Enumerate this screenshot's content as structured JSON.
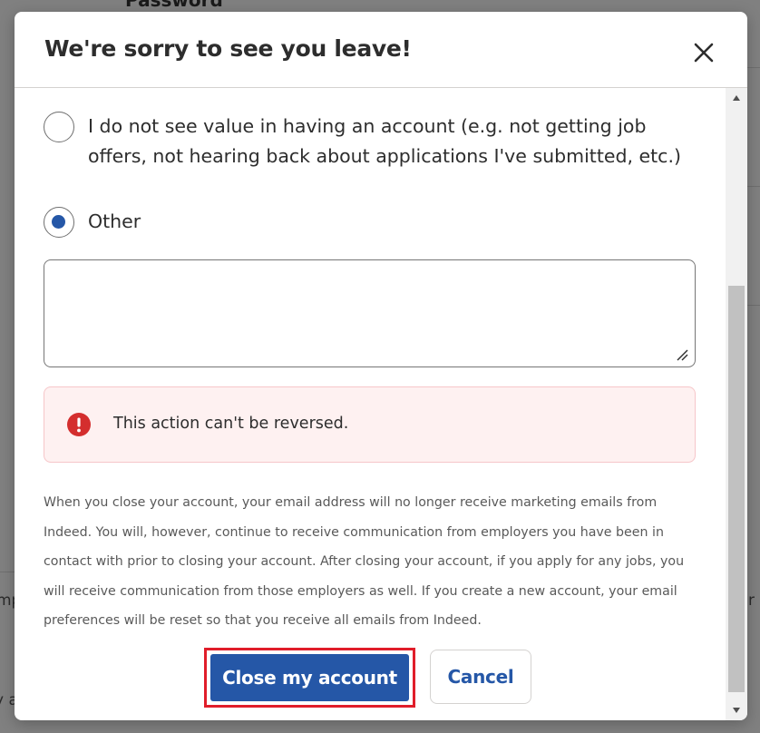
{
  "background": {
    "top_heading": "Password",
    "left_fragment_1": "mp",
    "left_fragment_2": "y a",
    "right_fragment_1": "r"
  },
  "modal": {
    "title": "We're sorry to see you leave!",
    "close_icon": "close-icon"
  },
  "options": [
    {
      "label": "I do not see value in having an account (e.g. not getting job offers, not hearing back about applications I've submitted, etc.)",
      "checked": false
    },
    {
      "label": "Other",
      "checked": true
    }
  ],
  "comment": {
    "value": ""
  },
  "alert": {
    "icon": "alert-circle-icon",
    "text": "This action can't be reversed.",
    "color": "#d42e2e"
  },
  "info": "When you close your account, your email address will no longer receive marketing emails from Indeed. You will, however, continue to receive communication from employers you have been in contact with prior to closing your account. After closing your account, if you apply for any jobs, you will receive communication from those employers as well. If you create a new account, your email preferences will be reset so that you receive all emails from Indeed.",
  "buttons": {
    "primary": "Close my account",
    "secondary": "Cancel"
  },
  "colors": {
    "accent": "#2557a7",
    "highlight": "#e01d2a"
  }
}
